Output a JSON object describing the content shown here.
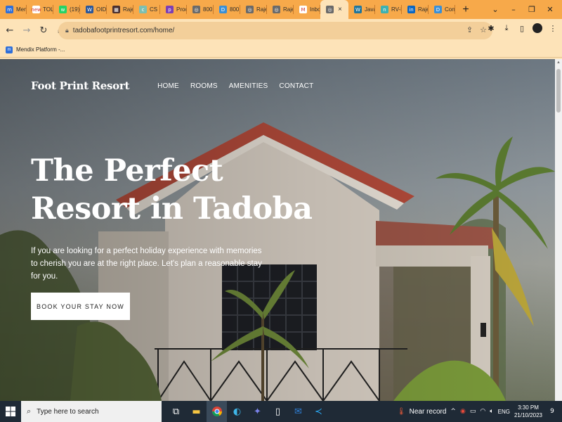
{
  "browser": {
    "tabs": [
      {
        "title": "Men",
        "fav_color": "#2f6fd8",
        "fav_glyph": "m"
      },
      {
        "title": "TOL",
        "fav_color": "#ffffff",
        "fav_glyph": "new"
      },
      {
        "title": "(19)",
        "fav_color": "#25d366",
        "fav_glyph": "w"
      },
      {
        "title": "OID",
        "fav_color": "#2b579a",
        "fav_glyph": "W"
      },
      {
        "title": "Raje",
        "fav_color": "#4a2f2f",
        "fav_glyph": "▦"
      },
      {
        "title": "CS E",
        "fav_color": "#7dbfb0",
        "fav_glyph": "c"
      },
      {
        "title": "Proc",
        "fav_color": "#7b3fb5",
        "fav_glyph": "p"
      },
      {
        "title": "800",
        "fav_color": "#6a6a6a",
        "fav_glyph": "◎"
      },
      {
        "title": "800",
        "fav_color": "#3a8fd6",
        "fav_glyph": "D"
      },
      {
        "title": "Raje",
        "fav_color": "#6a6a6a",
        "fav_glyph": "◎"
      },
      {
        "title": "Raje",
        "fav_color": "#6a6a6a",
        "fav_glyph": "◎"
      },
      {
        "title": "Inbo",
        "fav_color": "#ffffff",
        "fav_glyph": "M"
      },
      {
        "title": "",
        "fav_color": "#6a6a6a",
        "fav_glyph": "◎",
        "active": true
      },
      {
        "title": "Java",
        "fav_color": "#21759b",
        "fav_glyph": "W"
      },
      {
        "title": "RV-l",
        "fav_color": "#3db1b1",
        "fav_glyph": "n"
      },
      {
        "title": "Raje",
        "fav_color": "#0a66c2",
        "fav_glyph": "in"
      },
      {
        "title": "Con",
        "fav_color": "#3a8fd6",
        "fav_glyph": "D"
      }
    ],
    "new_tab_label": "+",
    "close_label": "×",
    "url": "tadobafootprintresort.com/home/",
    "bookmark": {
      "label": "Mendix Platform -...",
      "fav_glyph": "m"
    }
  },
  "site": {
    "logo": "Foot Print Resort",
    "nav": [
      "HOME",
      "ROOMS",
      "AMENITIES",
      "CONTACT"
    ],
    "hero_title": "The Perfect Resort in Tadoba",
    "hero_subtitle": "If you are looking for a perfect holiday experience with memories to cherish you are at the right place. Let's plan a reasonable stay for you.",
    "cta": "BOOK YOUR STAY NOW"
  },
  "taskbar": {
    "search_placeholder": "Type here to search",
    "weather": "Near record",
    "language": "ENG",
    "time": "3:30 PM",
    "date": "21/10/2023",
    "notification_count": "9"
  },
  "colors": {
    "browser_chrome": "#f7a94a",
    "toolbar": "#fde3b8",
    "taskbar": "#1f2a36",
    "cta_bg": "#ffffff"
  }
}
